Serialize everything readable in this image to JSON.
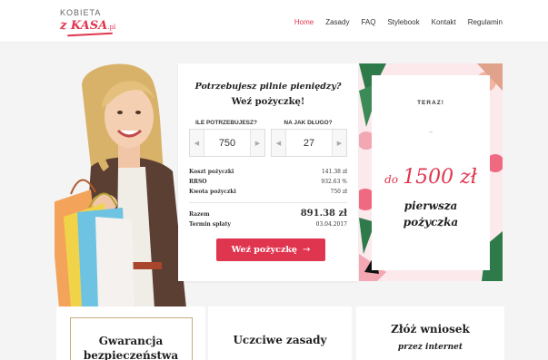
{
  "logo": {
    "top": "KOBIETA",
    "bottom": "z KASA",
    "suffix": ".pl"
  },
  "nav": [
    {
      "label": "Home",
      "active": true
    },
    {
      "label": "Zasady"
    },
    {
      "label": "FAQ"
    },
    {
      "label": "Stylebook"
    },
    {
      "label": "Kontakt"
    },
    {
      "label": "Regulamin"
    }
  ],
  "calculator": {
    "question": "Potrzebujesz pilnie pieniędzy?",
    "cta": "Weź pożyczkę!",
    "amount_label": "ILE POTRZEBUJESZ?",
    "amount_value": "750",
    "duration_label": "NA JAK DŁUGO?",
    "duration_value": "27",
    "rows": [
      {
        "key": "Koszt pożyczki",
        "value": "141.38 zł"
      },
      {
        "key": "RRSO",
        "value": "932.63 %"
      },
      {
        "key": "Kwota pożyczki",
        "value": "750 zł"
      }
    ],
    "total_label": "Razem",
    "total_value": "891.38 zł",
    "due_label": "Termin spłaty",
    "due_value": "03.04.2017",
    "button_label": "Weź pożyczkę",
    "button_arrow": "→"
  },
  "promo": {
    "teraz": "TERAZ!",
    "dash": "~",
    "amount_prefix": "do",
    "amount": "1500 zł",
    "line1": "pierwsza",
    "line2": "pożyczka"
  },
  "cards": {
    "c1_line1": "Gwarancja",
    "c1_line2": "bezpieczeństwa",
    "c2_title": "Uczciwe zasady",
    "c3_title": "Złóż wniosek",
    "c3_sub": "przez internet"
  },
  "colors": {
    "accent": "#e0354f",
    "gold": "#c9a97a"
  }
}
